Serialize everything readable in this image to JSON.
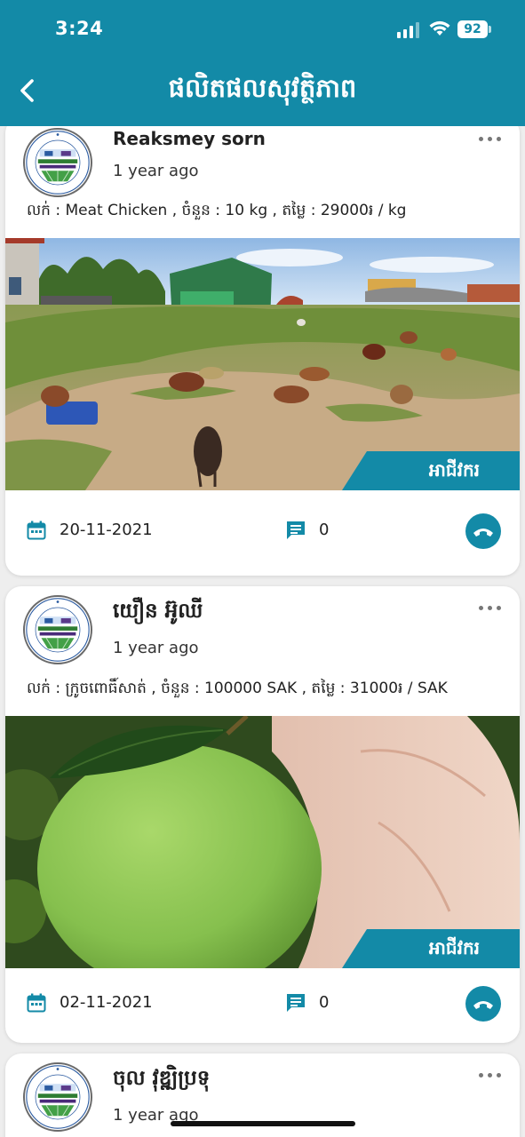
{
  "status_bar": {
    "time": "3:24",
    "battery": "92"
  },
  "header": {
    "title": "ផលិតផលសុវត្ថិភាព"
  },
  "colors": {
    "brand": "#138aa7",
    "background": "#eeeeee",
    "card": "#ffffff"
  },
  "posts": [
    {
      "author": "Reaksmey sorn",
      "time_ago": "1 year ago",
      "sale_line": "លក់ : Meat Chicken , ចំនួន : 10 kg , តម្លៃ : 29000៛ / kg",
      "image_subject": "free-range chickens in a yard",
      "tag": "អាជីវករ",
      "date": "20-11-2021",
      "comments": "0",
      "icons": {
        "date": "calendar-icon",
        "comments": "comment-icon",
        "call": "phone-icon",
        "more": "more-options-icon"
      }
    },
    {
      "author": "យឿន អ៊ូឈី",
      "time_ago": "1 year ago",
      "sale_line": "លក់ : ក្រូចពោធិ៍សាត់ , ចំនួន : 100000 SAK , តម្លៃ : 31000៛ / SAK",
      "image_subject": "green orange held in a hand",
      "tag": "អាជីវករ",
      "date": "02-11-2021",
      "comments": "0",
      "icons": {
        "date": "calendar-icon",
        "comments": "comment-icon",
        "call": "phone-icon",
        "more": "more-options-icon"
      }
    },
    {
      "author": "ចុល វុឌ្ឍិប្រទុ",
      "time_ago": "1 year ago"
    }
  ]
}
